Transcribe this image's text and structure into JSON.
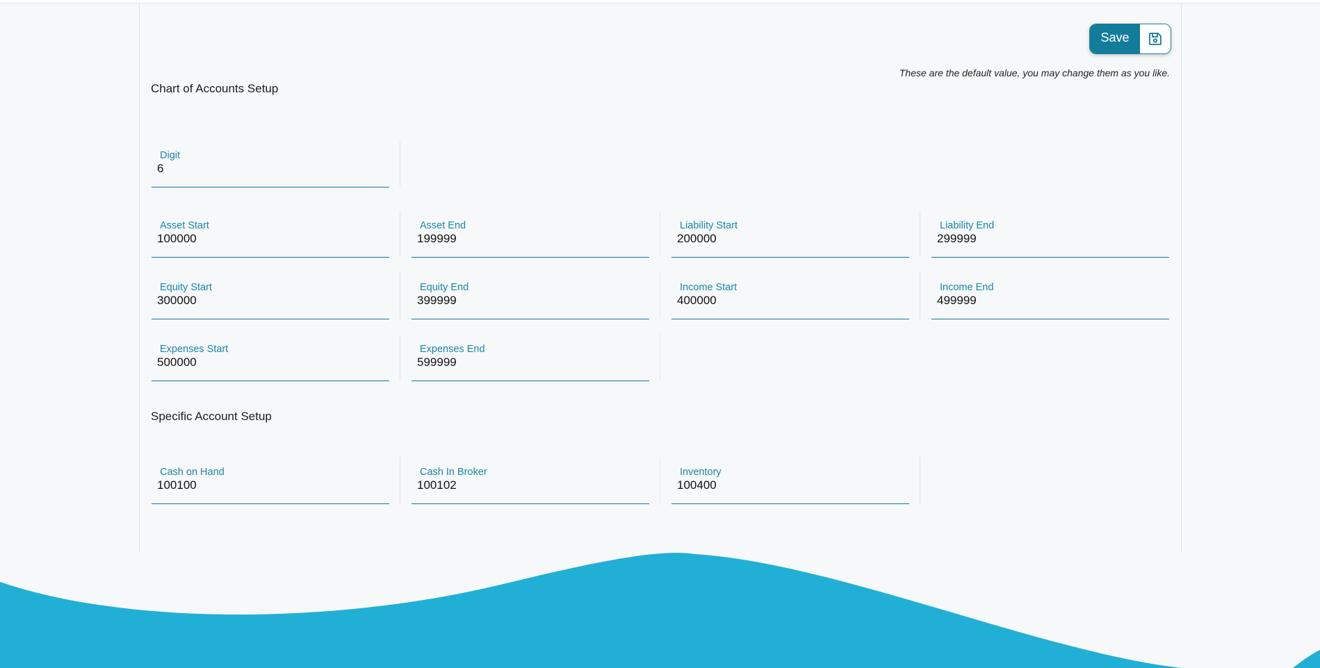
{
  "toolbar": {
    "save_label": "Save"
  },
  "hint_text": "These are the default value, you may change them as you like.",
  "sections": {
    "chart_of_accounts": "Chart of Accounts Setup",
    "specific_account": "Specific Account Setup"
  },
  "fields": {
    "digit": {
      "label": "Digit",
      "value": "6"
    },
    "asset_start": {
      "label": "Asset Start",
      "value": "100000"
    },
    "asset_end": {
      "label": "Asset End",
      "value": "199999"
    },
    "liability_start": {
      "label": "Liability Start",
      "value": "200000"
    },
    "liability_end": {
      "label": "Liability End",
      "value": "299999"
    },
    "equity_start": {
      "label": "Equity Start",
      "value": "300000"
    },
    "equity_end": {
      "label": "Equity End",
      "value": "399999"
    },
    "income_start": {
      "label": "Income Start",
      "value": "400000"
    },
    "income_end": {
      "label": "Income End",
      "value": "499999"
    },
    "expenses_start": {
      "label": "Expenses Start",
      "value": "500000"
    },
    "expenses_end": {
      "label": "Expenses End",
      "value": "599999"
    },
    "cash_on_hand": {
      "label": "Cash on Hand",
      "value": "100100"
    },
    "cash_in_broker": {
      "label": "Cash In Broker",
      "value": "100102"
    },
    "inventory": {
      "label": "Inventory",
      "value": "100400"
    }
  },
  "colors": {
    "accent": "#137c9b",
    "label": "#1b86a5",
    "wave": "#22afd6",
    "background": "#f6f8fa"
  },
  "icons": {
    "save": "floppy-disk-icon"
  }
}
